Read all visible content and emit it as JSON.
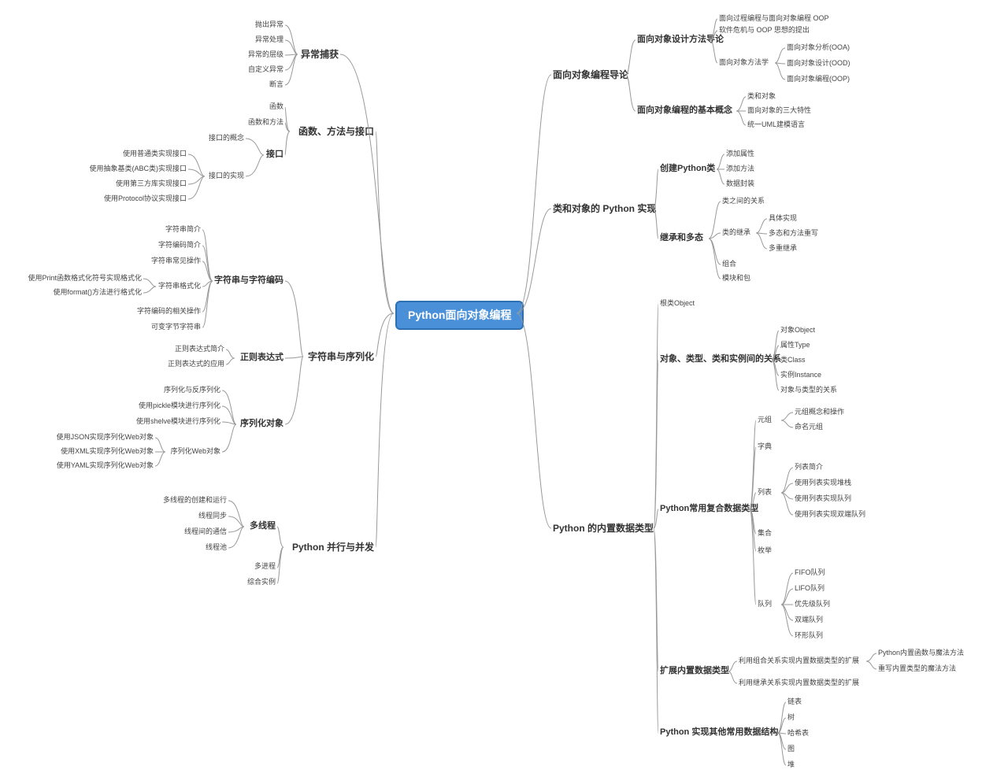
{
  "root": "Python面向对象编程",
  "left": {
    "b1": {
      "title": "异常捕获",
      "items": [
        "抛出异常",
        "异常处理",
        "异常的层级",
        "自定义异常",
        "断言"
      ]
    },
    "b2": {
      "title": "函数、方法与接口",
      "c1": "函数",
      "c2": "函数和方法",
      "c3": {
        "title": "接口",
        "d1": "接口的概念",
        "d2": {
          "title": "接口的实现",
          "items": [
            "使用普通类实现接口",
            "使用抽象基类(ABC类)实现接口",
            "使用第三方库实现接口",
            "使用Protocol协议实现接口"
          ]
        }
      }
    },
    "b3": {
      "title": "字符串与序列化",
      "c1": {
        "title": "字符串与字符编码",
        "d1": "字符串简介",
        "d2": "字符编码简介",
        "d3": "字符串常见操作",
        "d4": {
          "title": "字符串格式化",
          "items": [
            "使用Print函数格式化符号实现格式化",
            "使用format()方法进行格式化"
          ]
        },
        "d5": "字符编码的相关操作",
        "d6": "可变字节字符串"
      },
      "c2": {
        "title": "正则表达式",
        "items": [
          "正则表达式简介",
          "正则表达式的应用"
        ]
      },
      "c3": {
        "title": "序列化对象",
        "d1": "序列化与反序列化",
        "d2": "使用pickle模块进行序列化",
        "d3": "使用shelve模块进行序列化",
        "d4": {
          "title": "序列化Web对象",
          "items": [
            "使用JSON实现序列化Web对象",
            "使用XML实现序列化Web对象",
            "使用YAML实现序列化Web对象"
          ]
        }
      }
    },
    "b4": {
      "title": "Python 并行与并发",
      "c1": {
        "title": "多线程",
        "items": [
          "多线程的创建和运行",
          "线程同步",
          "线程间的通信",
          "线程池"
        ]
      },
      "c2": "多进程",
      "c3": "综合实例"
    }
  },
  "right": {
    "b1": {
      "title": "面向对象编程导论",
      "c1": {
        "title": "面向对象设计方法导论",
        "d1": "面向过程编程与面向对象编程 OOP",
        "d2": "软件危机与 OOP 思想的提出",
        "d3": {
          "title": "面向对象方法学",
          "items": [
            "面向对象分析(OOA)",
            "面向对象设计(OOD)",
            "面向对象编程(OOP)"
          ]
        }
      },
      "c2": {
        "title": "面向对象编程的基本概念",
        "items": [
          "类和对象",
          "面向对象的三大特性",
          "统一UML建模语言"
        ]
      }
    },
    "b2": {
      "title": "类和对象的 Python 实现",
      "c1": {
        "title": "创建Python类",
        "items": [
          "添加属性",
          "添加方法",
          "数据封装"
        ]
      },
      "c2": {
        "title": "继承和多态",
        "d1": "类之间的关系",
        "d2": {
          "title": "类的继承",
          "items": [
            "具体实现",
            "多态和方法重写",
            "多重继承"
          ]
        },
        "d3": "组合",
        "d4": "模块和包"
      }
    },
    "b3": {
      "title": "Python 的内置数据类型",
      "c1": "根类Object",
      "c2": {
        "title": "对象、类型、类和实例间的关系",
        "items": [
          "对象Object",
          "属性Type",
          "类Class",
          "实例Instance",
          "对象与类型的关系"
        ]
      },
      "c3": {
        "title": "Python常用复合数据类型",
        "d1": {
          "title": "元组",
          "items": [
            "元组概念和操作",
            "命名元组"
          ]
        },
        "d2": "字典",
        "d3": {
          "title": "列表",
          "items": [
            "列表简介",
            "使用列表实现堆栈",
            "使用列表实现队列",
            "使用列表实现双端队列"
          ]
        },
        "d4": "集合",
        "d5": "枚举",
        "d6": {
          "title": "队列",
          "items": [
            "FIFO队列",
            "LIFO队列",
            "优先级队列",
            "双端队列",
            "环形队列"
          ]
        }
      },
      "c4": {
        "title": "扩展内置数据类型",
        "d1": {
          "title": "利用组合关系实现内置数据类型的扩展",
          "items": [
            "Python内置函数与魔法方法",
            "重写内置类型的魔法方法"
          ]
        },
        "d2": "利用继承关系实现内置数据类型的扩展"
      },
      "c5": {
        "title": "Python 实现其他常用数据结构",
        "items": [
          "链表",
          "树",
          "哈希表",
          "图",
          "堆"
        ]
      }
    }
  }
}
